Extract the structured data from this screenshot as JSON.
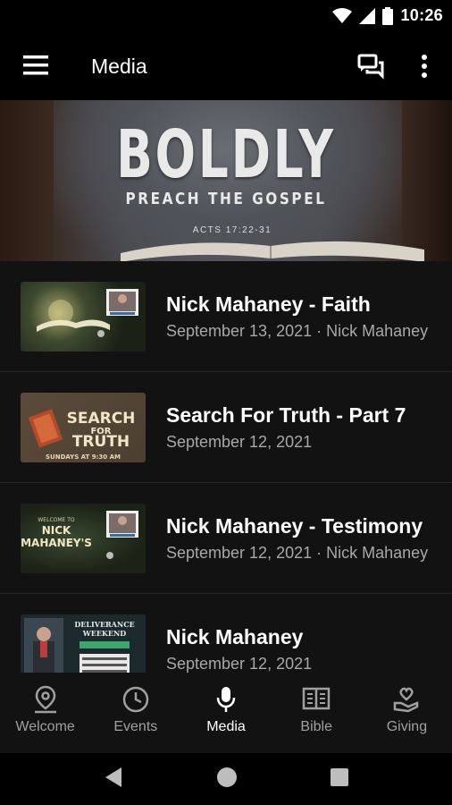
{
  "status": {
    "time": "10:26"
  },
  "app_bar": {
    "title": "Media"
  },
  "hero": {
    "title": "BOLDLY",
    "subtitle": "PREACH THE GOSPEL",
    "reference": "ACTS 17:22-31"
  },
  "media_items": [
    {
      "title": "Nick Mahaney - Faith",
      "subtitle": "September 13, 2021 · Nick Mahaney"
    },
    {
      "title": "Search For Truth - Part 7",
      "subtitle": "September 12, 2021",
      "thumb_text": {
        "line1": "SEARCH",
        "line2": "FOR",
        "line3": "TRUTH",
        "footer": "SUNDAYS AT 9:30 AM"
      }
    },
    {
      "title": "Nick Mahaney - Testimony",
      "subtitle": "September 12, 2021 · Nick Mahaney",
      "thumb_text": {
        "line1": "WELCOME TO",
        "line2": "NICK",
        "line3": "MAHANEY'S"
      }
    },
    {
      "title": "Nick Mahaney",
      "subtitle": "September 12, 2021",
      "thumb_text": {
        "line1": "DELIVERANCE",
        "line2": "WEEKEND"
      }
    }
  ],
  "bottom_nav": [
    {
      "label": "Welcome",
      "icon": "location-pin-icon",
      "active": false
    },
    {
      "label": "Events",
      "icon": "clock-icon",
      "active": false
    },
    {
      "label": "Media",
      "icon": "microphone-icon",
      "active": true
    },
    {
      "label": "Bible",
      "icon": "book-icon",
      "active": false
    },
    {
      "label": "Giving",
      "icon": "heart-hand-icon",
      "active": false
    }
  ],
  "colors": {
    "background": "#121212",
    "app_bar": "#000000",
    "subtitle": "#a8a8a8",
    "inactive_nav": "#a0a0a0"
  }
}
